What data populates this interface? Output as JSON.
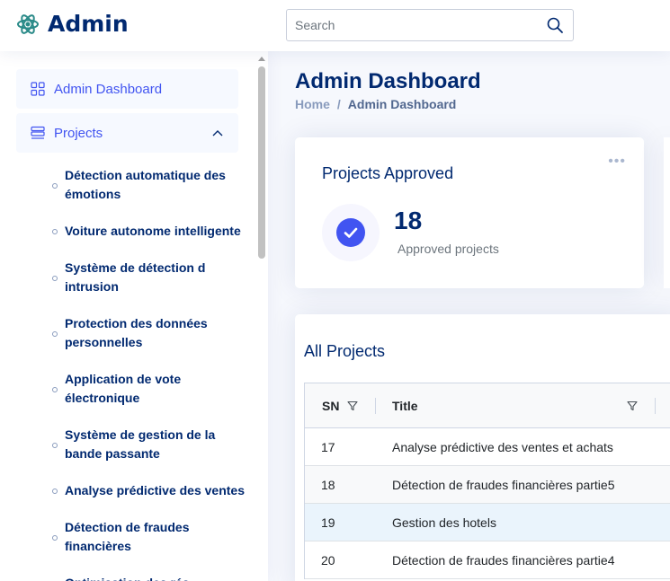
{
  "header": {
    "logo_text": "Admin",
    "search_placeholder": "Search"
  },
  "sidebar": {
    "dashboard_label": "Admin Dashboard",
    "projects_label": "Projects",
    "items": [
      "Détection automatique des émotions",
      "Voiture autonome intelligente",
      "Système de détection d intrusion",
      "Protection des données personnelles",
      "Application de vote électronique",
      "Système de gestion de la bande passante",
      "Analyse prédictive des ventes",
      "Détection de fraudes financières",
      "Optimisation des rés"
    ]
  },
  "main": {
    "page_title": "Admin Dashboard",
    "breadcrumb": {
      "home": "Home",
      "separator": "/",
      "current": "Admin Dashboard"
    },
    "projects_card": {
      "title": "Projects Approved",
      "more": "•••",
      "count": "18",
      "label": "Approved projects"
    },
    "all_projects": {
      "title": "All Projects",
      "columns": {
        "sn": "SN",
        "title": "Title"
      },
      "rows": [
        {
          "sn": "17",
          "title": "Analyse prédictive des ventes et achats"
        },
        {
          "sn": "18",
          "title": "Détection de fraudes financières partie5"
        },
        {
          "sn": "19",
          "title": "Gestion des hotels"
        },
        {
          "sn": "20",
          "title": "Détection de fraudes financières partie4"
        }
      ]
    }
  },
  "colors": {
    "primary": "#4154f1",
    "navy": "#012970",
    "muted": "#899bbd",
    "background": "#f6f8fd",
    "row_highlight": "#eaf4fc"
  }
}
